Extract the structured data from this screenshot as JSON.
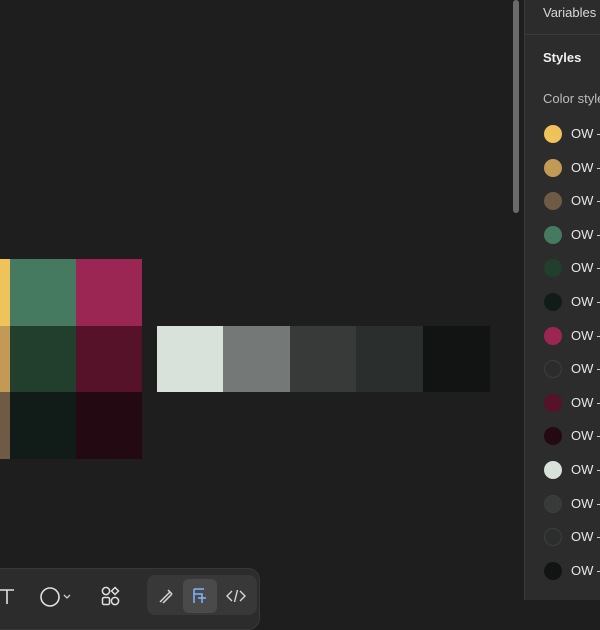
{
  "panel": {
    "header": "Variables",
    "section_title": "Styles",
    "group_title": "Color styles",
    "styles": [
      {
        "label": "OW – Yellow",
        "color": "#f0c35a"
      },
      {
        "label": "OW – Gold",
        "color": "#c29a55"
      },
      {
        "label": "OW – Brown",
        "color": "#6f5a45"
      },
      {
        "label": "OW – Green",
        "color": "#467a60"
      },
      {
        "label": "OW – Dark Green",
        "color": "#213f2c"
      },
      {
        "label": "OW – Deep Green",
        "color": "#111c18"
      },
      {
        "label": "OW – Magenta",
        "color": "#9c2653"
      },
      {
        "label": "OW – Blank",
        "color": "#2c2c2c"
      },
      {
        "label": "OW – Wine",
        "color": "#561228"
      },
      {
        "label": "OW – Deep Wine",
        "color": "#230911"
      },
      {
        "label": "OW – Mist",
        "color": "#d8e1da"
      },
      {
        "label": "OW – Charcoal",
        "color": "#373a39"
      },
      {
        "label": "OW – Slate",
        "color": "#2a2f2e"
      },
      {
        "label": "OW – Black",
        "color": "#121413"
      }
    ]
  },
  "canvas": {
    "grid_colors": [
      [
        "#f0c35a",
        "#467a60",
        "#9c2653"
      ],
      [
        "#c29a55",
        "#213f2c",
        "#561228"
      ],
      [
        "#6f5a45",
        "#111c18",
        "#230911"
      ]
    ],
    "neutral_colors": [
      "#d8e1da",
      "#747977",
      "#373a39",
      "#2a2f2e",
      "#121413"
    ]
  },
  "toolbar": {
    "tools": [
      {
        "name": "text-tool",
        "icon": "text-icon"
      },
      {
        "name": "shape-tool",
        "icon": "ellipse-icon"
      },
      {
        "name": "components-tool",
        "icon": "components-icon"
      },
      {
        "name": "draw-tool",
        "icon": "pen-icon"
      },
      {
        "name": "design-mode",
        "icon": "layers-icon"
      },
      {
        "name": "dev-mode",
        "icon": "code-icon"
      }
    ]
  }
}
